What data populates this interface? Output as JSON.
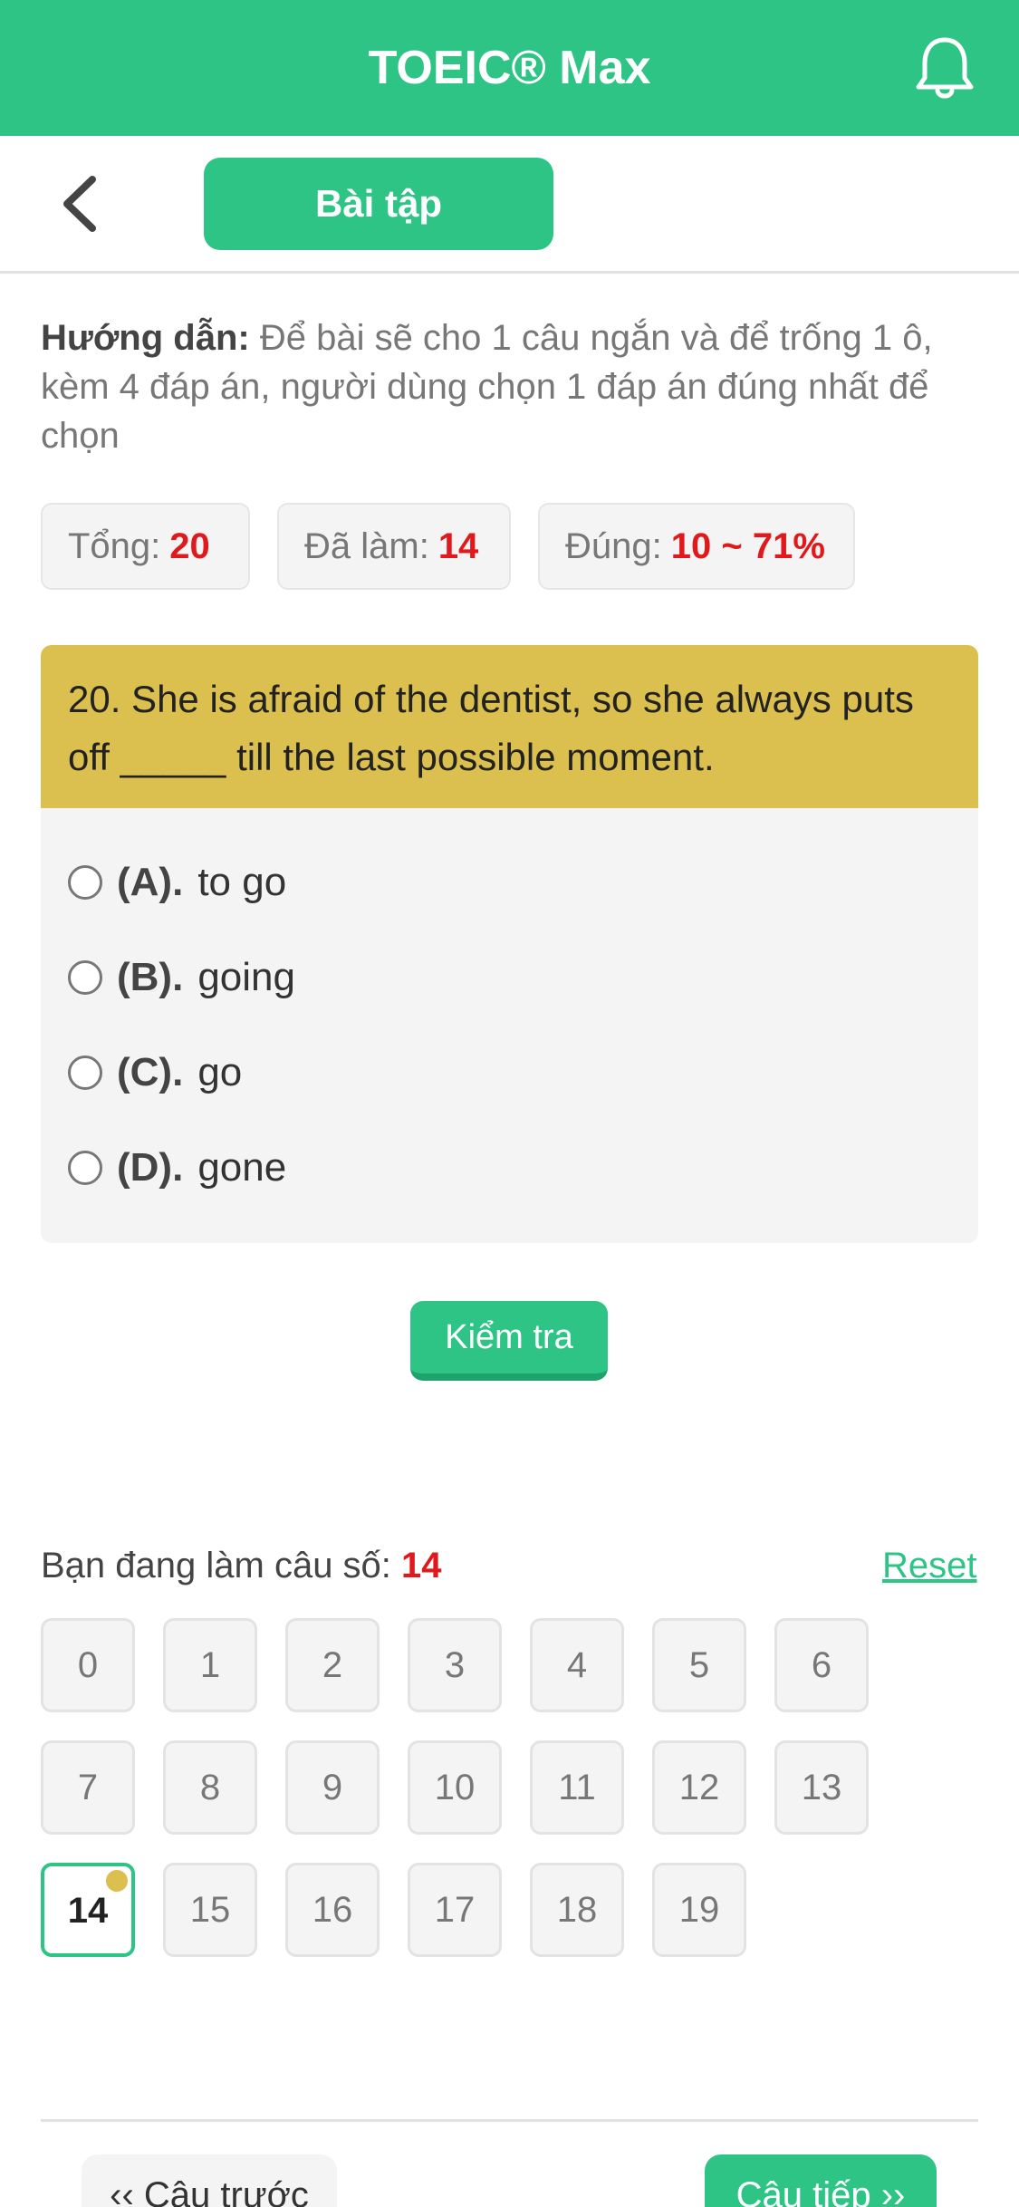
{
  "header": {
    "title": "TOEIC® Max",
    "icon": "bell-icon"
  },
  "subbar": {
    "back_icon": "chevron-left-icon",
    "tab_label": "Bài tập"
  },
  "instruction": {
    "label": "Hướng dẫn:",
    "text": "Để bài sẽ cho 1 câu ngắn và để trống 1 ô, kèm 4 đáp án, người dùng chọn 1 đáp án đúng nhất để chọn"
  },
  "stats": {
    "total_label": "Tổng:",
    "total_value": "20",
    "done_label": "Đã làm:",
    "done_value": "14",
    "correct_label": "Đúng:",
    "correct_value": "10 ~ 71%"
  },
  "question": {
    "text": "20. She is afraid of the dentist, so she always puts off _____ till the last possible moment.",
    "options": [
      {
        "letter": "(A).",
        "text": "to go"
      },
      {
        "letter": "(B).",
        "text": "going"
      },
      {
        "letter": "(C).",
        "text": "go"
      },
      {
        "letter": "(D).",
        "text": "gone"
      }
    ]
  },
  "check_button": "Kiểm tra",
  "progress": {
    "label": "Bạn đang làm câu số:",
    "current": "14",
    "reset": "Reset"
  },
  "question_grid": [
    "0",
    "1",
    "2",
    "3",
    "4",
    "5",
    "6",
    "7",
    "8",
    "9",
    "10",
    "11",
    "12",
    "13",
    "14",
    "15",
    "16",
    "17",
    "18",
    "19"
  ],
  "nav": {
    "prev": "‹‹ Câu trước",
    "next": "Câu tiếp ››"
  },
  "colors": {
    "accent": "#2ec486",
    "question_bg": "#dbbf4f",
    "highlight": "#e0191d"
  }
}
